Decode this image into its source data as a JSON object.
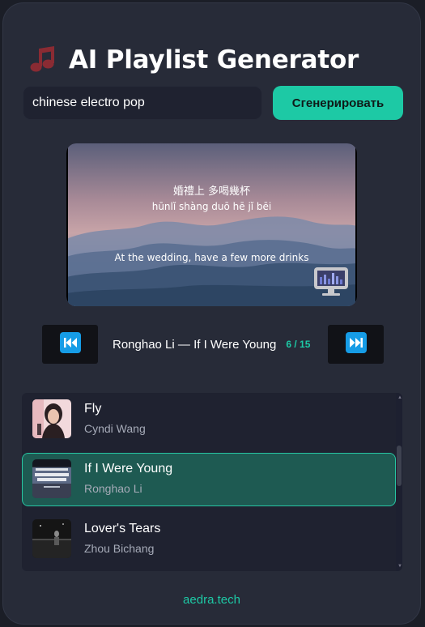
{
  "app": {
    "logo_icon": "musical-note-icon",
    "title": "AI Playlist Generator",
    "accent_color": "#1dc9a5"
  },
  "search": {
    "value": "chinese electro pop",
    "button_label": "Сгенерировать"
  },
  "video": {
    "lyric_chinese": "婚禮上 多喝幾杯",
    "lyric_pinyin": "hūnlǐ shàng duō hē jǐ bēi",
    "lyric_english": "At the wedding, have a few more drinks",
    "overlay_icon": "tv-icon"
  },
  "player": {
    "prev_icon": "skip-back-icon",
    "next_icon": "skip-forward-icon",
    "now_playing": "Ronghao Li — If I Were Young",
    "counter": "6 / 15"
  },
  "playlist": {
    "tracks": [
      {
        "title": "Fly",
        "artist": "Cyndi Wang",
        "active": false
      },
      {
        "title": "If I Were Young",
        "artist": "Ronghao Li",
        "active": true
      },
      {
        "title": "Lover's Tears",
        "artist": "Zhou Bichang",
        "active": false
      }
    ]
  },
  "footer": {
    "text": "aedra.tech"
  }
}
